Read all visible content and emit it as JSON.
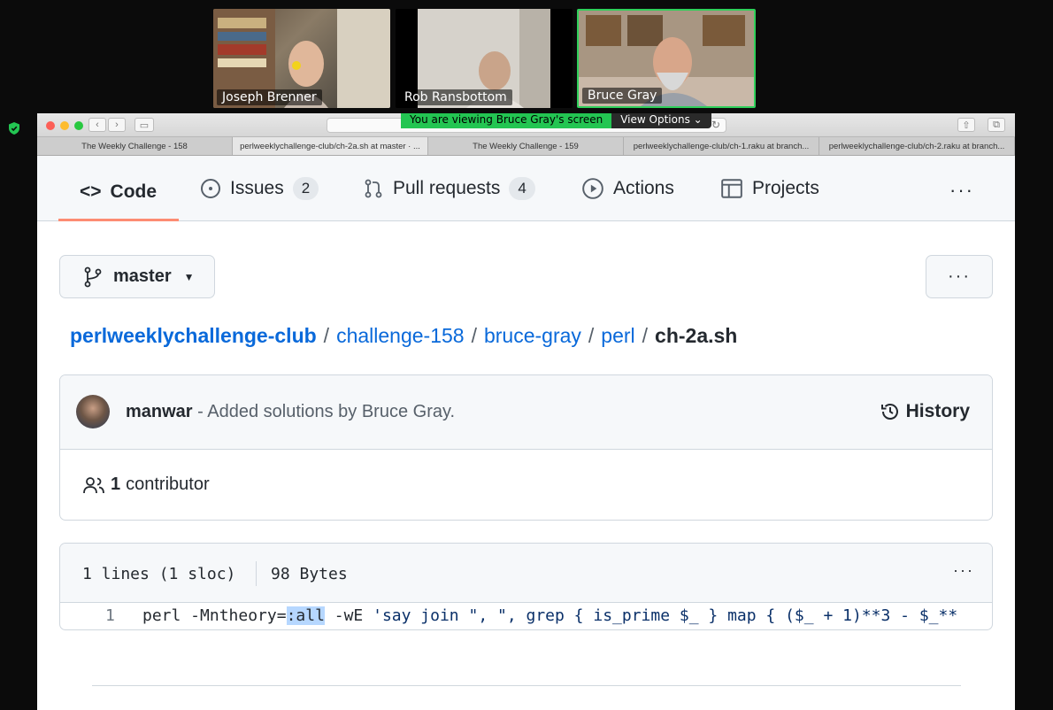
{
  "participants": [
    {
      "name": "Joseph Brenner"
    },
    {
      "name": "Rob Ransbottom"
    },
    {
      "name": "Bruce Gray"
    }
  ],
  "share_banner": {
    "viewing": "You are viewing Bruce Gray's screen",
    "options": "View Options"
  },
  "browser": {
    "tabs": [
      "The Weekly Challenge - 158",
      "perlweeklychallenge-club/ch-2a.sh at master · ...",
      "The Weekly Challenge - 159",
      "perlweeklychallenge-club/ch-1.raku at branch...",
      "perlweeklychallenge-club/ch-2.raku at branch..."
    ],
    "new_tab": "+"
  },
  "repo_nav": {
    "code": "Code",
    "issues": "Issues",
    "issues_count": "2",
    "pulls": "Pull requests",
    "pulls_count": "4",
    "actions": "Actions",
    "projects": "Projects",
    "more": "···"
  },
  "branch": {
    "name": "master"
  },
  "more_button": "···",
  "breadcrumb": {
    "repo": "perlweeklychallenge-club",
    "p1": "challenge-158",
    "p2": "bruce-gray",
    "p3": "perl",
    "file": "ch-2a.sh",
    "sep": "/"
  },
  "commit": {
    "author": "manwar",
    "message": "- Added solutions by Bruce Gray.",
    "history": "History",
    "contributors_count": "1",
    "contributors_label": "contributor"
  },
  "file": {
    "lines": "1 lines (1 sloc)",
    "size": "98 Bytes",
    "more": "···",
    "line_number": "1",
    "code_pre": "perl -Mntheory=",
    "code_sel": ":all",
    "code_mid": " -wE ",
    "code_str": "'say join \", \", grep { is_prime $_ } map { ($_ + 1)**3  -  $_**"
  },
  "colors": {
    "accent": "#0969da",
    "underline": "#fd8c73",
    "active_speaker": "#2fd05a",
    "share_green": "#23c552"
  }
}
